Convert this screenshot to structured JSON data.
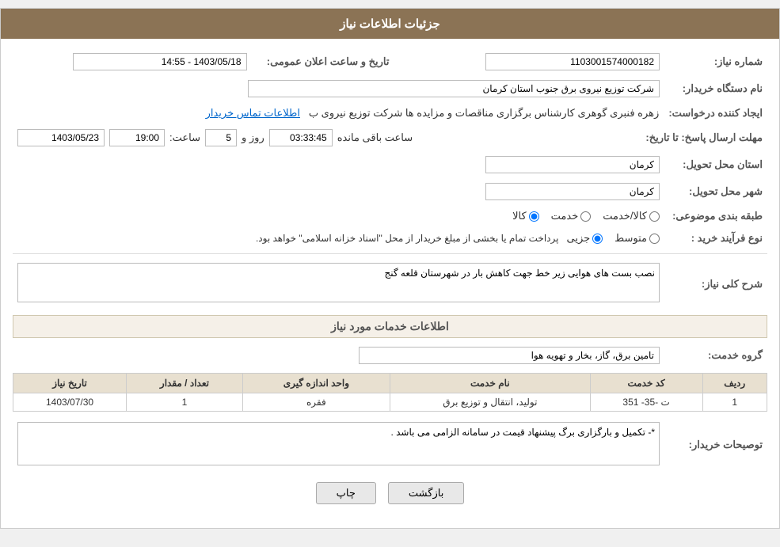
{
  "header": {
    "title": "جزئیات اطلاعات نیاز"
  },
  "fields": {
    "request_number_label": "شماره نیاز:",
    "request_number_value": "1103001574000182",
    "buyer_org_label": "نام دستگاه خریدار:",
    "buyer_org_value": "شرکت توزیع نیروی برق جنوب استان کرمان",
    "announce_date_label": "تاریخ و ساعت اعلان عمومی:",
    "announce_date_value": "1403/05/18 - 14:55",
    "creator_label": "ایجاد کننده درخواست:",
    "creator_value": "زهره فنبری گوهری کارشناس برگزاری مناقصات و مزایده ها شرکت توزیع نیروی ب",
    "creator_link": "اطلاعات تماس خریدار",
    "deadline_label": "مهلت ارسال پاسخ: تا تاریخ:",
    "deadline_date": "1403/05/23",
    "deadline_time_label": "ساعت:",
    "deadline_time": "19:00",
    "deadline_days_label": "روز و",
    "deadline_days": "5",
    "deadline_remaining_label": "ساعت باقی مانده",
    "deadline_remaining": "03:33:45",
    "delivery_province_label": "استان محل تحویل:",
    "delivery_province_value": "کرمان",
    "delivery_city_label": "شهر محل تحویل:",
    "delivery_city_value": "کرمان",
    "category_label": "طبقه بندی موضوعی:",
    "category_options": [
      "کالا",
      "خدمت",
      "کالا/خدمت"
    ],
    "category_selected": "کالا",
    "purchase_type_label": "نوع فرآیند خرید :",
    "purchase_type_options": [
      "جزیی",
      "متوسط"
    ],
    "purchase_type_note": "پرداخت تمام یا بخشی از مبلغ خریدار از محل \"اسناد خزانه اسلامی\" خواهد بود.",
    "purchase_type_selected": "جزیی"
  },
  "need_description": {
    "section_title": "شرح کلی نیاز:",
    "value": "نصب بست های هوایی زیر خط جهت کاهش بار در شهرستان قلعه گنج"
  },
  "services_section": {
    "title": "اطلاعات خدمات مورد نیاز",
    "service_group_label": "گروه خدمت:",
    "service_group_value": "تامین برق، گاز، بخار و تهویه هوا",
    "table": {
      "columns": [
        "ردیف",
        "کد خدمت",
        "نام خدمت",
        "واحد اندازه گیری",
        "تعداد / مقدار",
        "تاریخ نیاز"
      ],
      "rows": [
        {
          "row_num": "1",
          "service_code": "ت -35- 351",
          "service_name": "تولید، انتقال و توزیع برق",
          "unit": "فقره",
          "quantity": "1",
          "date": "1403/07/30"
        }
      ]
    }
  },
  "buyer_notes": {
    "section_title": "توصیحات خریدار:",
    "value": "*- تکمیل و بارگزاری برگ پیشنهاد قیمت در سامانه الزامی می باشد ."
  },
  "buttons": {
    "print_label": "چاپ",
    "back_label": "بازگشت"
  }
}
